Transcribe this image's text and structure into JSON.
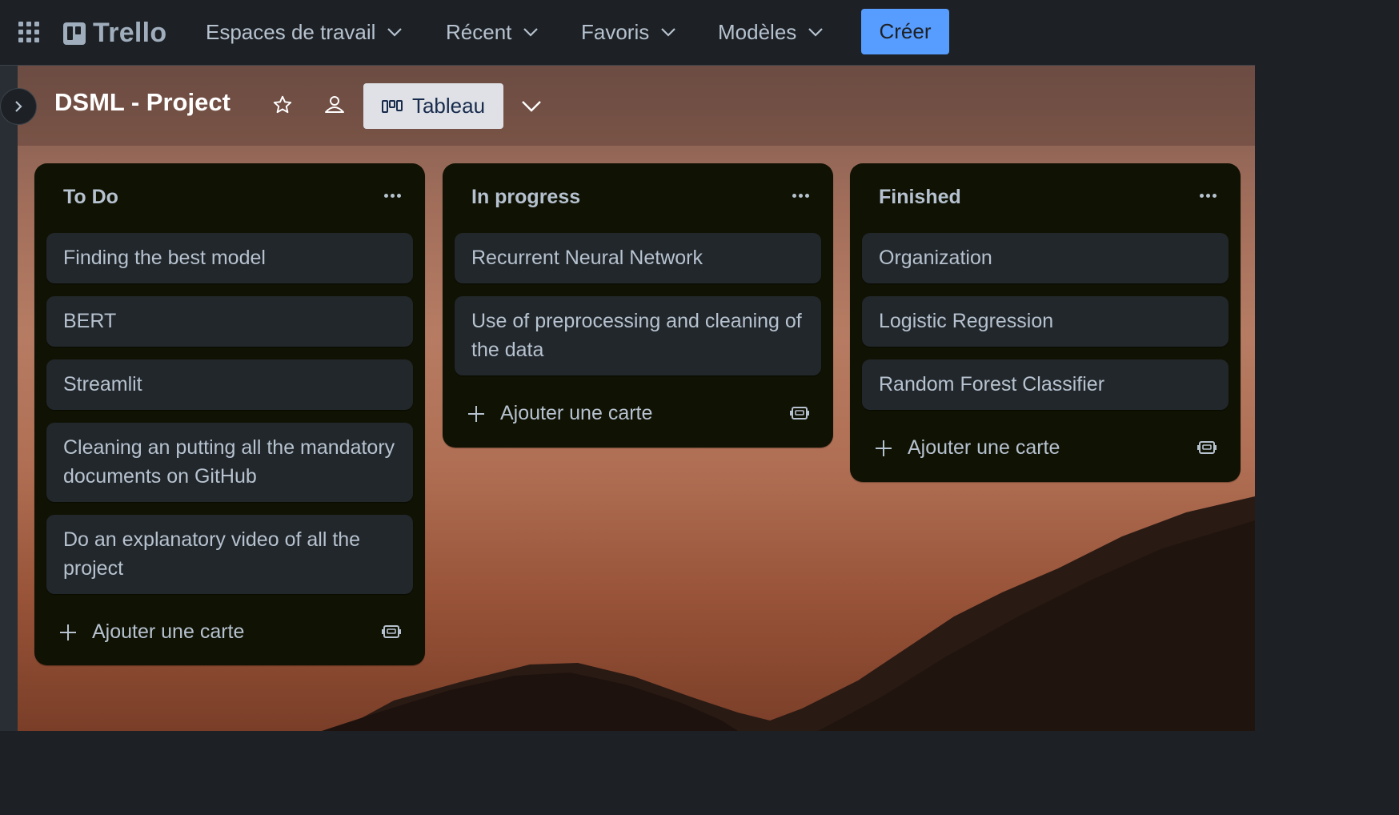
{
  "topnav": {
    "logo": "Trello",
    "items": [
      {
        "label": "Espaces de travail"
      },
      {
        "label": "Récent"
      },
      {
        "label": "Favoris"
      },
      {
        "label": "Modèles"
      }
    ],
    "create_label": "Créer",
    "accent": "#579dff"
  },
  "board": {
    "title": "DSML - Project",
    "view_label": "Tableau"
  },
  "lists": [
    {
      "title": "To Do",
      "cards": [
        "Finding the best model",
        "BERT",
        "Streamlit",
        "Cleaning an putting all the mandatory documents on GitHub",
        "Do an explanatory video of all the project"
      ],
      "add_label": "Ajouter une carte"
    },
    {
      "title": "In progress",
      "cards": [
        "Recurrent Neural Network",
        "Use of preprocessing and cleaning of the data"
      ],
      "add_label": "Ajouter une carte"
    },
    {
      "title": "Finished",
      "cards": [
        "Organization",
        "Logistic Regression",
        "Random Forest Classifier"
      ],
      "add_label": "Ajouter une carte"
    }
  ]
}
